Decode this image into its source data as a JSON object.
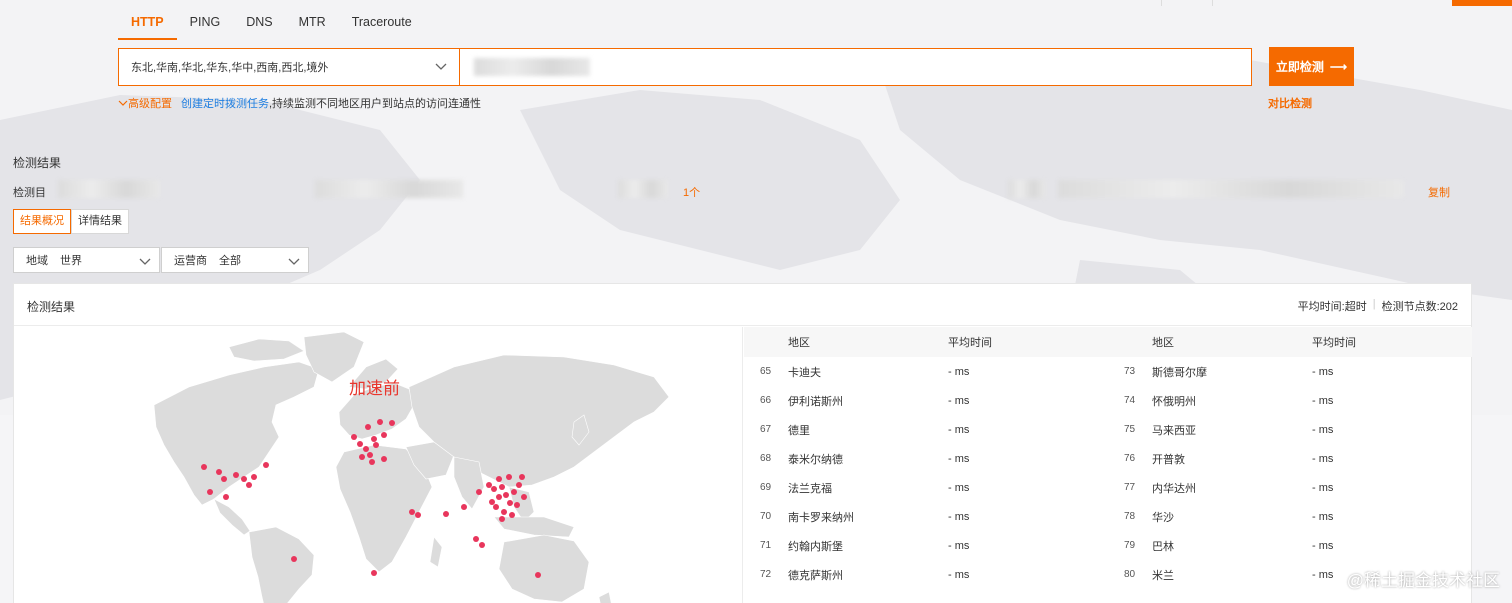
{
  "tabs": [
    {
      "label": "HTTP",
      "active": true
    },
    {
      "label": "PING",
      "active": false
    },
    {
      "label": "DNS",
      "active": false
    },
    {
      "label": "MTR",
      "active": false
    },
    {
      "label": "Traceroute",
      "active": false
    }
  ],
  "search": {
    "region_value": "东北,华南,华北,华东,华中,西南,西北,境外",
    "url_value": "",
    "detect_label": "立即检测",
    "detect_arrow": "⟶"
  },
  "advanced": {
    "config_label": "高级配置",
    "task_link": "创建定时拨测任务",
    "task_desc": ",持续监测不同地区用户到站点的访问连通性",
    "compare_label": "对比检测"
  },
  "result": {
    "title": "检测结果",
    "target_label": "检测目",
    "node_count": "1个",
    "copy_label": "复制",
    "tabs": [
      {
        "label": "结果概况",
        "active": true
      },
      {
        "label": "详情结果",
        "active": false
      }
    ]
  },
  "filters": {
    "region": {
      "label": "地域",
      "value": "世界"
    },
    "isp": {
      "label": "运营商",
      "value": "全部"
    }
  },
  "panel": {
    "title": "检测结果",
    "avg_time": "平均时间:超时",
    "node_total": "检测节点数:202",
    "map_label": "加速前"
  },
  "table": {
    "headers": {
      "region": "地区",
      "time": "平均时间"
    },
    "left": [
      {
        "idx": "65",
        "region": "卡迪夫",
        "time": "- ms"
      },
      {
        "idx": "66",
        "region": "伊利诺斯州",
        "time": "- ms"
      },
      {
        "idx": "67",
        "region": "德里",
        "time": "- ms"
      },
      {
        "idx": "68",
        "region": "泰米尔纳德",
        "time": "- ms"
      },
      {
        "idx": "69",
        "region": "法兰克福",
        "time": "- ms"
      },
      {
        "idx": "70",
        "region": "南卡罗来纳州",
        "time": "- ms"
      },
      {
        "idx": "71",
        "region": "约翰内斯堡",
        "time": "- ms"
      },
      {
        "idx": "72",
        "region": "德克萨斯州",
        "time": "- ms"
      }
    ],
    "right": [
      {
        "idx": "73",
        "region": "斯德哥尔摩",
        "time": "- ms"
      },
      {
        "idx": "74",
        "region": "怀俄明州",
        "time": "- ms"
      },
      {
        "idx": "75",
        "region": "马来西亚",
        "time": "- ms"
      },
      {
        "idx": "76",
        "region": "开普敦",
        "time": "- ms"
      },
      {
        "idx": "77",
        "region": "内华达州",
        "time": "- ms"
      },
      {
        "idx": "78",
        "region": "华沙",
        "time": "- ms"
      },
      {
        "idx": "79",
        "region": "巴林",
        "time": "- ms"
      },
      {
        "idx": "80",
        "region": "米兰",
        "time": "- ms"
      }
    ]
  },
  "watermark": "@稀土掘金技术社区",
  "colors": {
    "accent": "#f56a00",
    "link": "#1e7ee0",
    "node": "#e8365c",
    "map_label": "#e8362d"
  }
}
